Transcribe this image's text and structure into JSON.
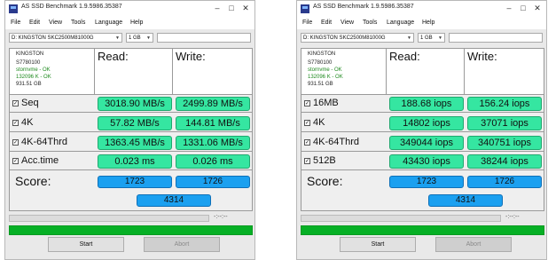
{
  "windows": [
    {
      "title": "AS SSD Benchmark 1.9.5986.35387",
      "menu": [
        "File",
        "Edit",
        "View",
        "Tools",
        "Language",
        "Help"
      ],
      "drive_select": "D: KINGSTON SKC2500M81000G",
      "size_select": "1 GB",
      "drive_info": {
        "name": "KINGSTON",
        "firmware": "S7780100",
        "driver": "stornvme - OK",
        "align": "132096 K - OK",
        "capacity": "931.51 GB"
      },
      "col_read": "Read:",
      "col_write": "Write:",
      "rows": [
        {
          "label": "Seq",
          "read": "3018.90 MB/s",
          "write": "2499.89 MB/s"
        },
        {
          "label": "4K",
          "read": "57.82 MB/s",
          "write": "144.81 MB/s"
        },
        {
          "label": "4K-64Thrd",
          "read": "1363.45 MB/s",
          "write": "1331.06 MB/s"
        },
        {
          "label": "Acc.time",
          "read": "0.023 ms",
          "write": "0.026 ms"
        }
      ],
      "score_label": "Score:",
      "score_read": "1723",
      "score_write": "1726",
      "score_total": "4314",
      "time_display": "-:--:--",
      "start_label": "Start",
      "abort_label": "Abort"
    },
    {
      "title": "AS SSD Benchmark 1.9.5986.35387",
      "menu": [
        "File",
        "Edit",
        "View",
        "Tools",
        "Language",
        "Help"
      ],
      "drive_select": "D: KINGSTON SKC2500M81000G",
      "size_select": "1 GB",
      "drive_info": {
        "name": "KINGSTON",
        "firmware": "S7780100",
        "driver": "stornvme - OK",
        "align": "132096 K - OK",
        "capacity": "931.51 GB"
      },
      "col_read": "Read:",
      "col_write": "Write:",
      "rows": [
        {
          "label": "16MB",
          "read": "188.68 iops",
          "write": "156.24 iops"
        },
        {
          "label": "4K",
          "read": "14802 iops",
          "write": "37071 iops"
        },
        {
          "label": "4K-64Thrd",
          "read": "349044 iops",
          "write": "340751 iops"
        },
        {
          "label": "512B",
          "read": "43430 iops",
          "write": "38244 iops"
        }
      ],
      "score_label": "Score:",
      "score_read": "1723",
      "score_write": "1726",
      "score_total": "4314",
      "time_display": "-:--:--",
      "start_label": "Start",
      "abort_label": "Abort"
    }
  ],
  "colors": {
    "result_fill": "#35e6a1",
    "score_fill": "#1ba0f0",
    "progress_fill": "#06b025",
    "status_ok": "#1e8a1e"
  }
}
